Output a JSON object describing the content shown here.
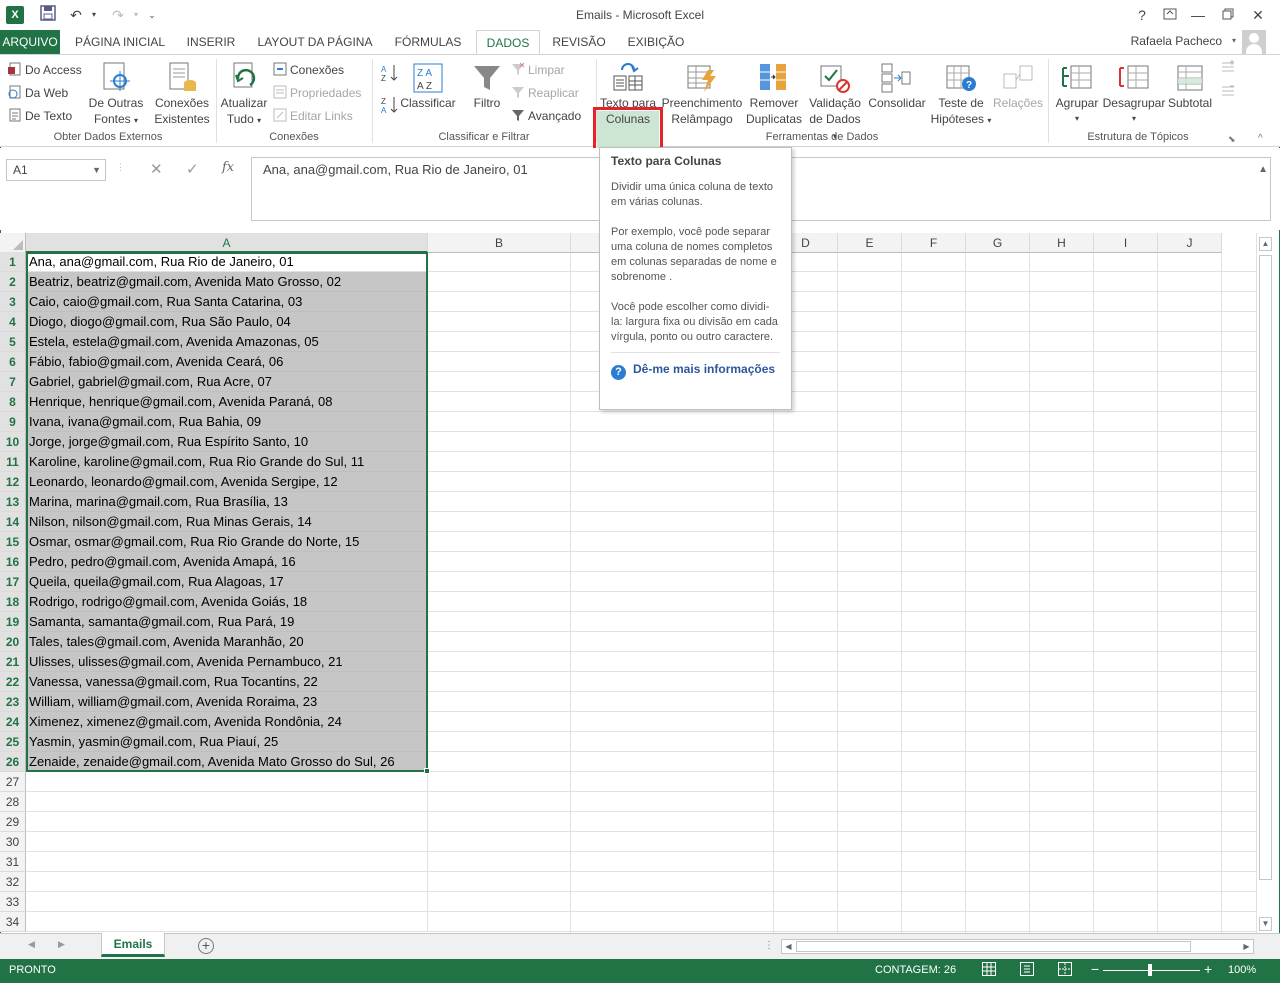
{
  "window": {
    "title": "Emails - Microsoft Excel",
    "help": "?",
    "controls": [
      "ribbon-options",
      "minimize",
      "restore",
      "close"
    ]
  },
  "tabs": [
    "ARQUIVO",
    "PÁGINA INICIAL",
    "INSERIR",
    "LAYOUT DA PÁGINA",
    "FÓRMULAS",
    "DADOS",
    "REVISÃO",
    "EXIBIÇÃO"
  ],
  "active_tab": "DADOS",
  "user": {
    "name": "Rafaela Pacheco"
  },
  "ribbon": {
    "external": {
      "label": "Obter Dados Externos",
      "access": "Do Access",
      "web": "Da Web",
      "text": "De Texto",
      "other_sources_1": "De Outras",
      "other_sources_2": "Fontes",
      "existing_1": "Conexões",
      "existing_2": "Existentes"
    },
    "connections": {
      "label": "Conexões",
      "refresh_1": "Atualizar",
      "refresh_2": "Tudo",
      "conexoes": "Conexões",
      "propriedades": "Propriedades",
      "editar_links": "Editar Links"
    },
    "sort": {
      "label": "Classificar e Filtrar",
      "classificar": "Classificar",
      "filtro": "Filtro",
      "limpar": "Limpar",
      "reaplicar": "Reaplicar",
      "avancado": "Avançado"
    },
    "tools": {
      "label": "Ferramentas de Dados",
      "text_cols_1": "Texto para",
      "text_cols_2": "Colunas",
      "flash_1": "Preenchimento",
      "flash_2": "Relâmpago",
      "remove_1": "Remover",
      "remove_2": "Duplicatas",
      "validation_1": "Validação",
      "validation_2": "de Dados",
      "consolidate": "Consolidar",
      "whatif_1": "Teste de",
      "whatif_2": "Hipóteses",
      "relations": "Relações"
    },
    "outline": {
      "label": "Estrutura de Tópicos",
      "group": "Agrupar",
      "ungroup": "Desagrupar",
      "subtotal": "Subtotal"
    }
  },
  "formula_bar": {
    "name_box": "A1",
    "fx": "fx",
    "value": "Ana, ana@gmail.com, Rua Rio de Janeiro, 01"
  },
  "tooltip": {
    "title": "Texto para Colunas",
    "p1": "Dividir uma única coluna de texto em várias colunas.",
    "p2": "Por exemplo, você pode separar uma coluna de nomes completos em colunas separadas de nome e sobrenome .",
    "p3": "Você pode escolher como dividi-la: largura fixa ou divisão em cada vírgula, ponto ou outro caractere.",
    "link": "Dê-me mais informações"
  },
  "columns": [
    "A",
    "B",
    "C",
    "D",
    "E",
    "F",
    "G",
    "H",
    "I",
    "J"
  ],
  "rows": [
    "1",
    "2",
    "3",
    "4",
    "5",
    "6",
    "7",
    "8",
    "9",
    "10",
    "11",
    "12",
    "13",
    "14",
    "15",
    "16",
    "17",
    "18",
    "19",
    "20",
    "21",
    "22",
    "23",
    "24",
    "25",
    "26",
    "27",
    "28",
    "29",
    "30",
    "31",
    "32",
    "33",
    "34"
  ],
  "cells_a": [
    "Ana, ana@gmail.com, Rua Rio de Janeiro, 01",
    "Beatriz, beatriz@gmail.com, Avenida Mato Grosso, 02",
    "Caio, caio@gmail.com, Rua Santa Catarina, 03",
    "Diogo, diogo@gmail.com, Rua São Paulo, 04",
    "Estela, estela@gmail.com, Avenida Amazonas, 05",
    "Fábio, fabio@gmail.com, Avenida Ceará, 06",
    "Gabriel, gabriel@gmail.com, Rua Acre, 07",
    "Henrique, henrique@gmail.com, Avenida Paraná, 08",
    "Ivana, ivana@gmail.com, Rua Bahia, 09",
    "Jorge, jorge@gmail.com, Rua Espírito Santo, 10",
    "Karoline, karoline@gmail.com, Rua Rio Grande do Sul, 11",
    "Leonardo, leonardo@gmail.com, Avenida Sergipe, 12",
    "Marina, marina@gmail.com, Rua Brasília, 13",
    "Nilson, nilson@gmail.com, Rua Minas Gerais, 14",
    "Osmar, osmar@gmail.com, Rua Rio Grande do Norte, 15",
    "Pedro, pedro@gmail.com, Avenida Amapá, 16",
    "Queila, queila@gmail.com, Rua Alagoas, 17",
    "Rodrigo, rodrigo@gmail.com, Avenida Goiás, 18",
    "Samanta, samanta@gmail.com, Rua Pará, 19",
    "Tales, tales@gmail.com, Avenida Maranhão, 20",
    "Ulisses, ulisses@gmail.com, Avenida Pernambuco, 21",
    "Vanessa, vanessa@gmail.com, Rua Tocantins, 22",
    "William, william@gmail.com, Avenida Roraima, 23",
    "Ximenez, ximenez@gmail.com, Avenida Rondônia, 24",
    "Yasmin, yasmin@gmail.com, Rua Piauí, 25",
    "Zenaide, zenaide@gmail.com, Avenida Mato Grosso do Sul, 26"
  ],
  "sheet": {
    "tab": "Emails",
    "add": "+"
  },
  "status": {
    "mode": "PRONTO",
    "count": "CONTAGEM: 26",
    "zoom": "100%",
    "zoom_minus": "−",
    "zoom_plus": "+"
  },
  "colors": {
    "accent": "#217346",
    "highlight": "#e8222b",
    "selection_fill": "#c6c6c6",
    "link": "#2b579a"
  }
}
